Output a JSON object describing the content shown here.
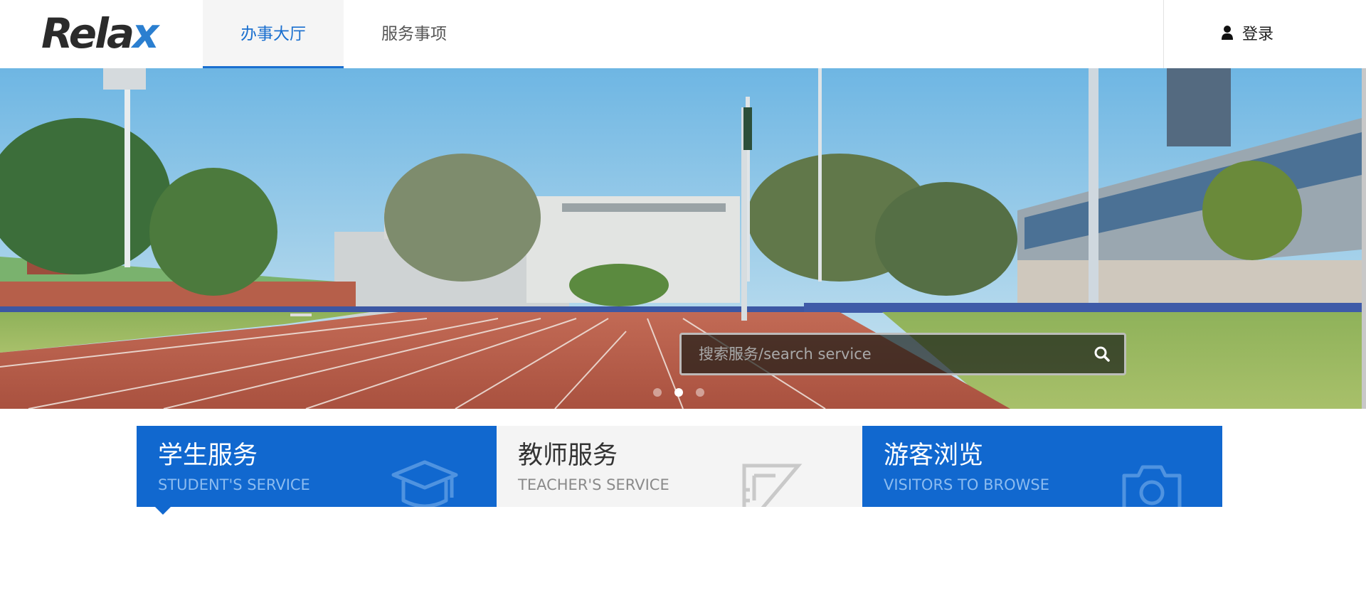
{
  "header": {
    "logo": {
      "text_main": "Rela",
      "text_accent": "x"
    },
    "tabs": [
      {
        "label": "办事大厅",
        "active": true
      },
      {
        "label": "服务事项",
        "active": false
      }
    ],
    "login_label": "登录"
  },
  "banner": {
    "search": {
      "placeholder": "搜索服务/search service",
      "value": ""
    },
    "carousel": {
      "slides": 3,
      "active_index": 1
    }
  },
  "cards": [
    {
      "title": "学生服务",
      "subtitle": "STUDENT'S SERVICE",
      "icon": "graduation-cap-icon",
      "style": "blue",
      "selected": true
    },
    {
      "title": "教师服务",
      "subtitle": "TEACHER'S SERVICE",
      "icon": "ruler-triangle-icon",
      "style": "grey",
      "selected": false
    },
    {
      "title": "游客浏览",
      "subtitle": "VISITORS TO BROWSE",
      "icon": "camera-icon",
      "style": "blue",
      "selected": false
    }
  ],
  "colors": {
    "brand_blue": "#1168cf",
    "tab_active": "#1a6fcf",
    "logo_text": "#2b2b2b",
    "logo_accent": "#2b7fd0",
    "track_red": "#b85a48",
    "card_grey": "#f4f4f4"
  }
}
